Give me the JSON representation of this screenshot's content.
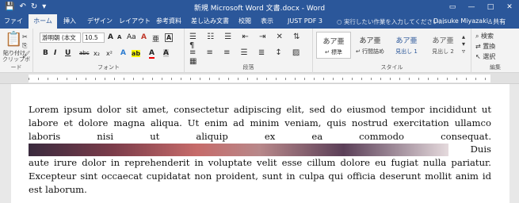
{
  "titlebar": {
    "title": "新規 Microsoft Word 文書.docx - Word",
    "save_icon": "💾",
    "undo_icon": "↶",
    "redo_icon": "↻",
    "qat_more": "▾",
    "restore_icon": "▭",
    "minimize": "—",
    "maximize": "□",
    "close": "✕"
  },
  "tabs": [
    "ファイル",
    "ホーム",
    "挿入",
    "デザイン",
    "レイアウト",
    "参考資料",
    "差し込み文書",
    "校閲",
    "表示",
    "JUST PDF 3"
  ],
  "tellme": "実行したい作業を入力してください...",
  "user": "Daisuke Miyazaki",
  "share": "共有",
  "ribbon": {
    "clipboard": {
      "paste": "貼り付け",
      "label": "クリップボード"
    },
    "font": {
      "name": "游明朝 (本文",
      "size": "10.5",
      "grow": "A",
      "shrink": "A",
      "case": "Aa",
      "clear": "A",
      "phonetic": "亜",
      "enclose": "A",
      "bold": "B",
      "italic": "I",
      "underline": "U",
      "strike": "abc",
      "sub": "x₂",
      "sup": "x²",
      "effects": "A",
      "highlight": "ab",
      "color": "A",
      "shade": "A",
      "label": "フォント"
    },
    "paragraph": {
      "label": "段落"
    },
    "styles": {
      "items": [
        {
          "sample": "あア亜",
          "name": "↵ 標準"
        },
        {
          "sample": "あア亜",
          "name": "↵ 行間詰め"
        },
        {
          "sample": "あア亜",
          "name": "見出し 1"
        },
        {
          "sample": "あア亜",
          "name": "見出し 2"
        }
      ],
      "label": "スタイル"
    },
    "editing": {
      "find": "検索",
      "replace": "置換",
      "select": "選択",
      "label": "編集"
    }
  },
  "document": {
    "text_before": "Lorem ipsum dolor sit amet, consectetur adipiscing elit, sed do eiusmod tempor incididunt ut labore et dolore magna aliqua. Ut enim ad minim veniam, quis nostrud exercitation ullamco laboris nisi ut aliquip ex ea commodo consequat.",
    "line_duis": "Duis",
    "text_after": "aute irure dolor in reprehenderit in voluptate velit esse cillum dolore eu fugiat nulla pariatur. Excepteur sint occaecat cupidatat non proident, sunt in culpa qui officia deserunt mollit anim id est laborum.",
    "para_mark": "↵"
  },
  "colors": {
    "accent": "#2b579a",
    "spell": "#e03030"
  }
}
